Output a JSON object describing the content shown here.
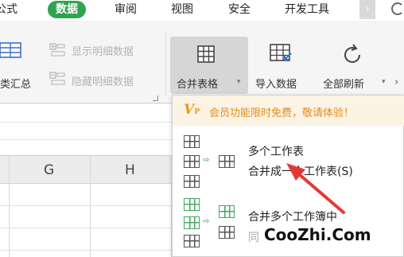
{
  "menubar": {
    "tabs": [
      {
        "label": "公式"
      },
      {
        "label": "数据",
        "active": true
      },
      {
        "label": "审阅"
      },
      {
        "label": "视图"
      },
      {
        "label": "安全"
      },
      {
        "label": "开发工具"
      }
    ],
    "scroll_glyph": "›"
  },
  "ribbon": {
    "subtotal_label": "类汇总",
    "show_detail_label": "显示明细数据",
    "hide_detail_label": "隐藏明细数据",
    "merge_tables_label": "合并表格",
    "import_data_label": "导入数据",
    "refresh_all_label": "全部刷新",
    "caret_glyph": "▾"
  },
  "sheet": {
    "columns": [
      "G",
      "H"
    ]
  },
  "dropdown": {
    "promo_text": "会员功能限时免费，敬请体验！",
    "promo_icon": "V",
    "promo_icon_sub": "P",
    "items": [
      {
        "title": "多个工作表",
        "subtitle": "合并成一个工作表(S)"
      },
      {
        "title": "合并多个工作簿中",
        "subtitle": "同"
      }
    ]
  },
  "annotation": {
    "arrow_color": "#e53935"
  },
  "watermark": "CooZhi.Com",
  "colors": {
    "accent": "#2ea44f",
    "promo": "#e68a1a"
  }
}
